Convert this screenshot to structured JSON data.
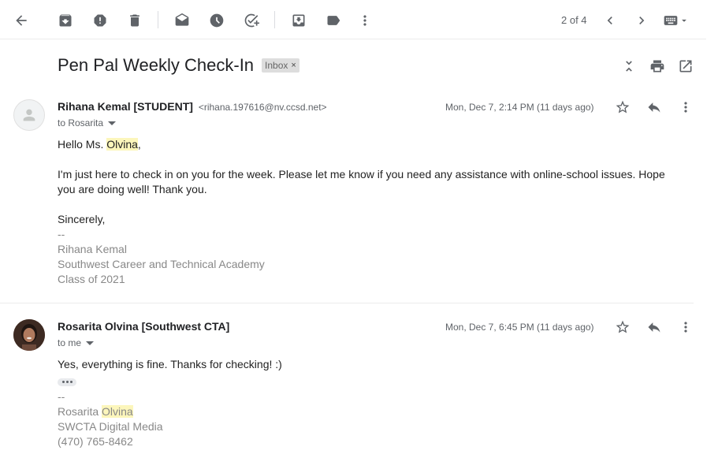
{
  "toolbar": {
    "pager_text": "2 of 4"
  },
  "thread": {
    "subject": "Pen Pal Weekly Check-In",
    "label": "Inbox",
    "label_remove": "×"
  },
  "messages": [
    {
      "sender_name": "Rihana Kemal [STUDENT]",
      "sender_email": "<rihana.197616@nv.ccsd.net>",
      "to": "to Rosarita",
      "date": "Mon, Dec 7, 2:14 PM (11 days ago)",
      "greeting_pre": "Hello Ms. ",
      "greeting_hl": "Olvina",
      "greeting_post": ",",
      "paragraph": "I'm just here to check in on you for the week. Please let me know if you need any assistance with online-school issues. Hope you are doing well! Thank you.",
      "closing": "Sincerely,",
      "sig_dash": "--",
      "sig_name": "Rihana Kemal",
      "sig_school": "Southwest Career and Technical Academy",
      "sig_class": "Class of 2021"
    },
    {
      "sender_name": "Rosarita Olvina [Southwest CTA]",
      "to": "to me",
      "date": "Mon, Dec 7, 6:45 PM (11 days ago)",
      "body": "Yes, everything is fine. Thanks for checking! :)",
      "sig_dash": "--",
      "sig_name_pre": "Rosarita ",
      "sig_name_hl": "Olvina",
      "sig_org": "SWCTA Digital Media",
      "sig_phone": "(470) 765-8462"
    }
  ]
}
